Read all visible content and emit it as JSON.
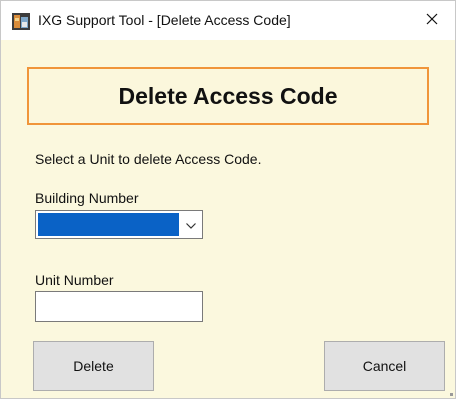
{
  "window": {
    "title": "IXG Support Tool - [Delete Access Code]",
    "app_icon": "ixg-app-icon",
    "close_icon": "close-icon"
  },
  "dialog": {
    "heading": "Delete Access Code",
    "instruction": "Select a Unit to delete Access Code.",
    "building_number": {
      "label": "Building Number",
      "selected_value": "",
      "dropdown_icon": "chevron-down-icon"
    },
    "unit_number": {
      "label": "Unit Number",
      "value": "",
      "placeholder": ""
    },
    "buttons": {
      "delete_label": "Delete",
      "cancel_label": "Cancel"
    }
  },
  "colors": {
    "background": "#fbf8de",
    "header_border": "#f0953a",
    "selection_highlight": "#0a62c6",
    "button_face": "#e1e1e1"
  }
}
